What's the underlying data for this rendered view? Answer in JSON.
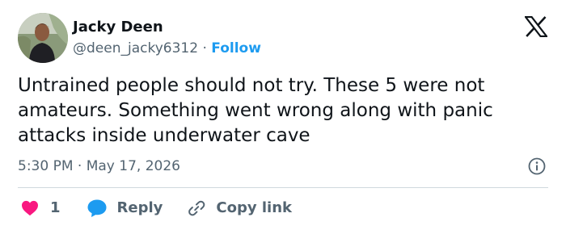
{
  "author": {
    "display_name": "Jacky Deen",
    "handle": "@deen_jacky6312",
    "separator": " · ",
    "follow_label": "Follow"
  },
  "tweet": {
    "text": "Untrained people should not try. These 5 were not amateurs. Something went wrong along with panic attacks inside underwater cave",
    "time": "5:30 PM",
    "date": "May 17, 2026",
    "meta_separator": " · "
  },
  "actions": {
    "like_count": "1",
    "reply_label": "Reply",
    "copy_link_label": "Copy link"
  },
  "icons": {
    "logo": "x-logo-icon",
    "info": "info-icon",
    "like": "heart-icon",
    "reply": "speech-bubble-icon",
    "copy": "link-icon"
  },
  "colors": {
    "text": "#0f1419",
    "secondary": "#536471",
    "accent": "#1d9bf0",
    "like": "#f91880",
    "divider": "#cfd9de"
  }
}
